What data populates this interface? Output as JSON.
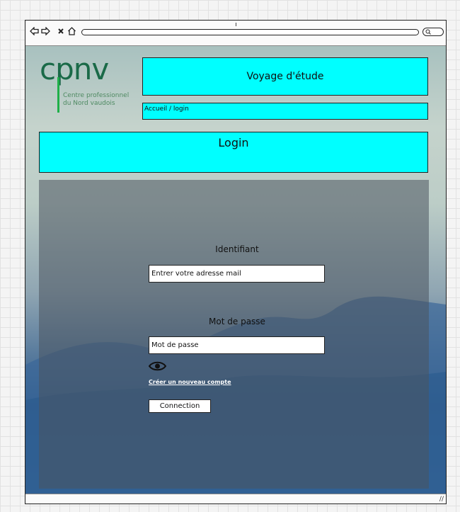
{
  "browser": {
    "nav": {
      "back_icon": "back-arrow-icon",
      "forward_icon": "forward-arrow-icon",
      "close_icon": "close-icon",
      "home_icon": "home-icon"
    },
    "search_icon": "search-icon"
  },
  "logo": {
    "wordmark": "cpnv",
    "line1": "Centre professionnel",
    "line2": "du Nord vaudois",
    "color": "#1a6a48",
    "bar_color": "#1fb049"
  },
  "header": {
    "site_title": "Voyage d'étude",
    "breadcrumb": "Accueil / login",
    "page_title": "Login",
    "accent_color": "#00ffff"
  },
  "login_form": {
    "identifier_label": "Identifiant",
    "identifier_value": "Entrer votre adresse mail",
    "password_label": "Mot de passe",
    "password_value": "Mot de passe",
    "show_password_icon": "eye-icon",
    "create_account_link": "Créer un nouveau compte",
    "submit_label": "Connection"
  }
}
